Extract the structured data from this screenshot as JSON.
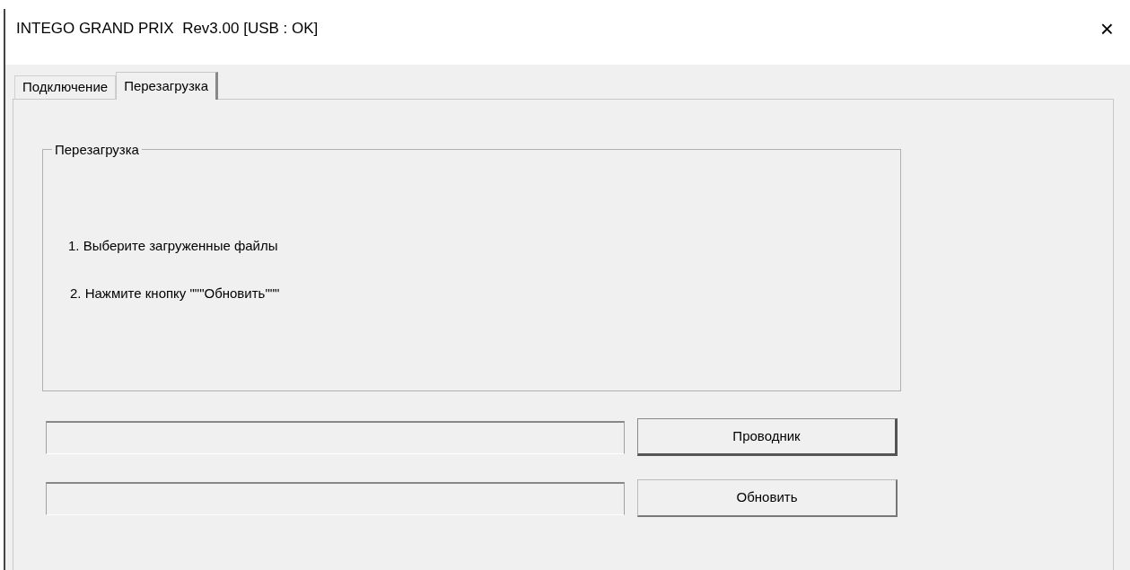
{
  "window": {
    "title": "INTEGO GRAND PRIX  Rev3.00 [USB : OK]",
    "close": "×"
  },
  "tabs": [
    {
      "label": "Подключение",
      "selected": false
    },
    {
      "label": "Перезагрузка",
      "selected": true
    }
  ],
  "group": {
    "title": "Перезагрузка",
    "steps": [
      "1. Выберите загруженные файлы",
      "2. Нажмите кнопку \"\"\"Обновить\"\"\""
    ]
  },
  "rows": [
    {
      "button": "Проводник",
      "default": true
    },
    {
      "button": "Обновить",
      "default": false
    }
  ]
}
